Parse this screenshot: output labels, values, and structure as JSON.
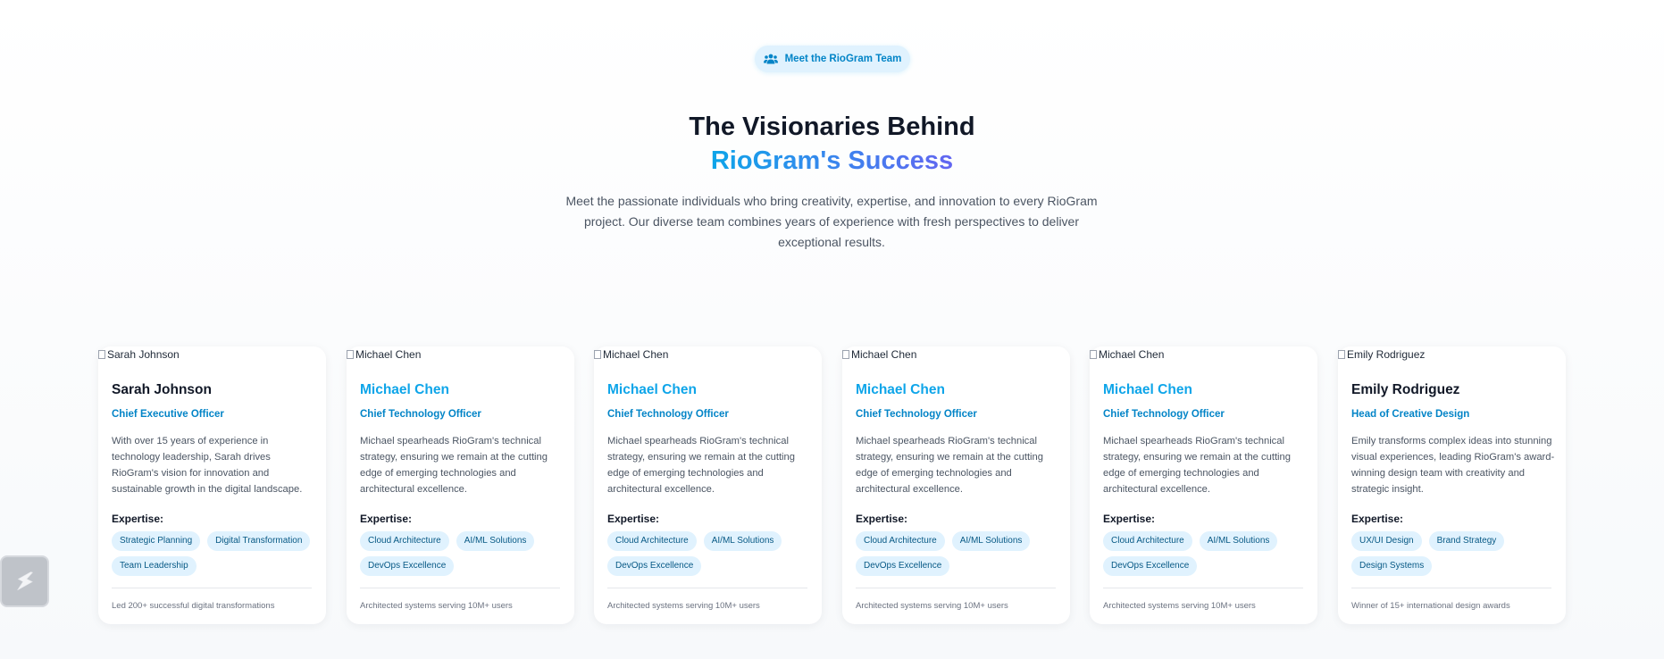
{
  "badge": {
    "icon": "users-icon",
    "label": "Meet the RioGram Team"
  },
  "heading": {
    "line1": "The Visionaries Behind",
    "line2": "RioGram's Success",
    "gradient": [
      "#0ea5e9",
      "#6366f1"
    ]
  },
  "subtitle": "Meet the passionate individuals who bring creativity, expertise, and innovation to every RioGram project. Our diverse team combines years of experience with fresh perspectives to deliver exceptional results.",
  "floating_button": {
    "icon": "lightning-bolt-icon"
  },
  "expertise_label": "Expertise:",
  "colors": {
    "accent": "#0284c7",
    "tag_bg": "#e0f2fe",
    "heading": "#111827"
  },
  "team": [
    {
      "image_alt": "Sarah Johnson",
      "name": "Sarah Johnson",
      "name_color": "#111827",
      "role": "Chief Executive Officer",
      "bio": "With over 15 years of experience in technology leadership, Sarah drives RioGram's vision for innovation and sustainable growth in the digital landscape.",
      "tags": [
        "Strategic Planning",
        "Digital Transformation",
        "Team Leadership"
      ],
      "achievement": "Led 200+ successful digital transformations"
    },
    {
      "image_alt": "Michael Chen",
      "name": "Michael Chen",
      "name_color": "#0ea5e9",
      "role": "Chief Technology Officer",
      "bio": "Michael spearheads RioGram's technical strategy, ensuring we remain at the cutting edge of emerging technologies and architectural excellence.",
      "tags": [
        "Cloud Architecture",
        "AI/ML Solutions",
        "DevOps Excellence"
      ],
      "achievement": "Architected systems serving 10M+ users"
    },
    {
      "image_alt": "Michael Chen",
      "name": "Michael Chen",
      "name_color": "#0ea5e9",
      "role": "Chief Technology Officer",
      "bio": "Michael spearheads RioGram's technical strategy, ensuring we remain at the cutting edge of emerging technologies and architectural excellence.",
      "tags": [
        "Cloud Architecture",
        "AI/ML Solutions",
        "DevOps Excellence"
      ],
      "achievement": "Architected systems serving 10M+ users"
    },
    {
      "image_alt": "Michael Chen",
      "name": "Michael Chen",
      "name_color": "#0ea5e9",
      "role": "Chief Technology Officer",
      "bio": "Michael spearheads RioGram's technical strategy, ensuring we remain at the cutting edge of emerging technologies and architectural excellence.",
      "tags": [
        "Cloud Architecture",
        "AI/ML Solutions",
        "DevOps Excellence"
      ],
      "achievement": "Architected systems serving 10M+ users"
    },
    {
      "image_alt": "Michael Chen",
      "name": "Michael Chen",
      "name_color": "#0ea5e9",
      "role": "Chief Technology Officer",
      "bio": "Michael spearheads RioGram's technical strategy, ensuring we remain at the cutting edge of emerging technologies and architectural excellence.",
      "tags": [
        "Cloud Architecture",
        "AI/ML Solutions",
        "DevOps Excellence"
      ],
      "achievement": "Architected systems serving 10M+ users"
    },
    {
      "image_alt": "Emily Rodriguez",
      "name": "Emily Rodriguez",
      "name_color": "#111827",
      "role": "Head of Creative Design",
      "bio": "Emily transforms complex ideas into stunning visual experiences, leading RioGram's award-winning design team with creativity and strategic insight.",
      "tags": [
        "UX/UI Design",
        "Brand Strategy",
        "Design Systems"
      ],
      "achievement": "Winner of 15+ international design awards"
    }
  ]
}
